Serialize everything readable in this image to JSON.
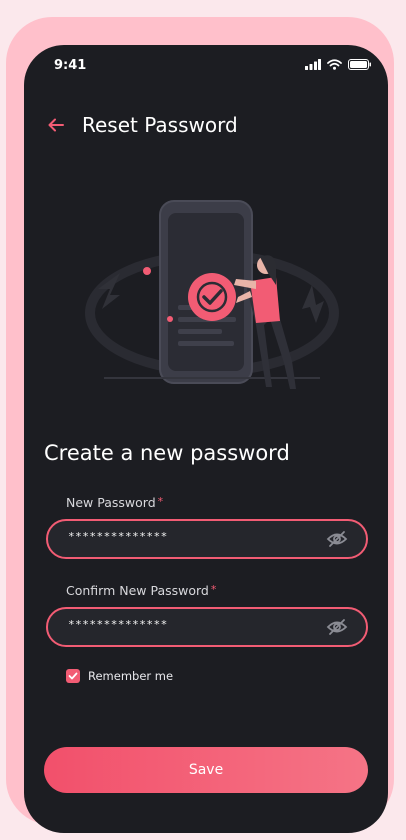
{
  "status_bar": {
    "time": "9:41",
    "icons": [
      "signal-icon",
      "wifi-icon",
      "battery-icon"
    ]
  },
  "header": {
    "back_icon": "arrow-left-icon",
    "title": "Reset Password"
  },
  "illustration": {
    "icons": [
      "checkmark-icon"
    ]
  },
  "main": {
    "heading": "Create a new password",
    "fields": [
      {
        "label": "New Password",
        "required_mark": "*",
        "value": "**************",
        "toggle_icon": "eye-off-icon"
      },
      {
        "label": "Confirm New Password",
        "required_mark": "*",
        "value": "**************",
        "toggle_icon": "eye-off-icon"
      }
    ],
    "remember": {
      "label": "Remember me",
      "checked": true
    },
    "save_label": "Save"
  },
  "colors": {
    "accent": "#f25c74",
    "background": "#1c1d22",
    "frame": "#ffc0cb",
    "field_background": "#25262c"
  }
}
